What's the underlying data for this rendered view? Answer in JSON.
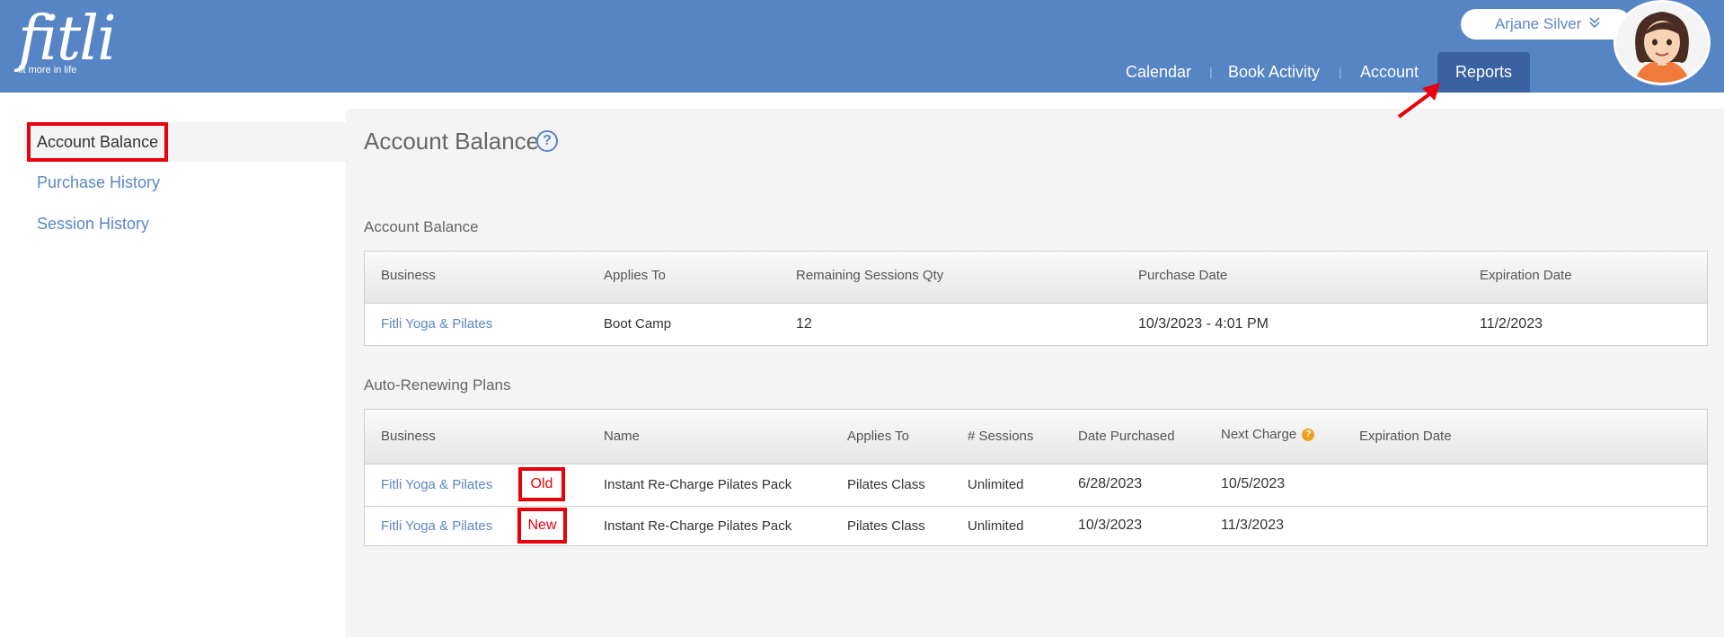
{
  "header": {
    "logo_text": "fitli",
    "logo_tagline": "fit more in life",
    "user_name": "Arjane Silver",
    "nav": [
      {
        "label": "Calendar"
      },
      {
        "label": "Book Activity"
      },
      {
        "label": "Account"
      },
      {
        "label": "Reports"
      }
    ],
    "nav_active": "Reports",
    "separator": "|"
  },
  "sidebar": {
    "items": [
      {
        "label": "Account Balance",
        "active": true
      },
      {
        "label": "Purchase History",
        "active": false
      },
      {
        "label": "Session History",
        "active": false
      }
    ]
  },
  "main": {
    "title": "Account Balance",
    "help_glyph": "?",
    "account_balance": {
      "title": "Account Balance",
      "headers": [
        "Business",
        "Applies To",
        "Remaining Sessions Qty",
        "Purchase Date",
        "Expiration Date"
      ],
      "rows": [
        [
          "Fitli Yoga & Pilates",
          "Boot Camp",
          "12",
          "10/3/2023 - 4:01 PM",
          "11/2/2023"
        ]
      ]
    },
    "auto_renewing": {
      "title": "Auto-Renewing Plans",
      "headers": [
        "Business",
        "Name",
        "Applies To",
        "# Sessions",
        "Date Purchased",
        "Next Charge",
        "Expiration Date"
      ],
      "info_glyph": "?",
      "rows": [
        {
          "cells": [
            "Fitli Yoga & Pilates",
            "Instant Re-Charge Pilates Pack",
            "Pilates Class",
            "Unlimited",
            "6/28/2023",
            "10/5/2023",
            ""
          ],
          "tag": "Old"
        },
        {
          "cells": [
            "Fitli Yoga & Pilates",
            "Instant Re-Charge Pilates Pack",
            "Pilates Class",
            "Unlimited",
            "10/3/2023",
            "11/3/2023",
            ""
          ],
          "tag": "New"
        }
      ]
    }
  },
  "colors": {
    "header_bg": "#5585c5",
    "nav_active_bg": "#3a62a0",
    "link": "#5b87c3",
    "annotation_red": "#e8000b",
    "panel_bg": "#f4f4f4"
  },
  "icons": [
    "user-dropdown-chevron-icon",
    "help-circle-icon",
    "info-badge-icon",
    "annotation-arrow"
  ]
}
